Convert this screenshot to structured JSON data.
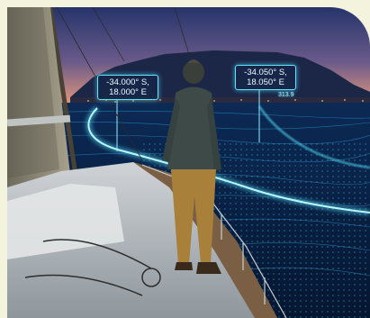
{
  "overlay": {
    "marker_1": {
      "line1": "-34.000° S,",
      "line2": "18.000° E"
    },
    "marker_2": {
      "line1": "-34.050° S,",
      "line2": "18.050° E"
    },
    "distance": "313.9"
  },
  "colors": {
    "frame": "#f3f3de",
    "glow": "#5fe6ff",
    "sky_top": "#2a3a6e",
    "sky_bottom": "#e79a7c"
  }
}
